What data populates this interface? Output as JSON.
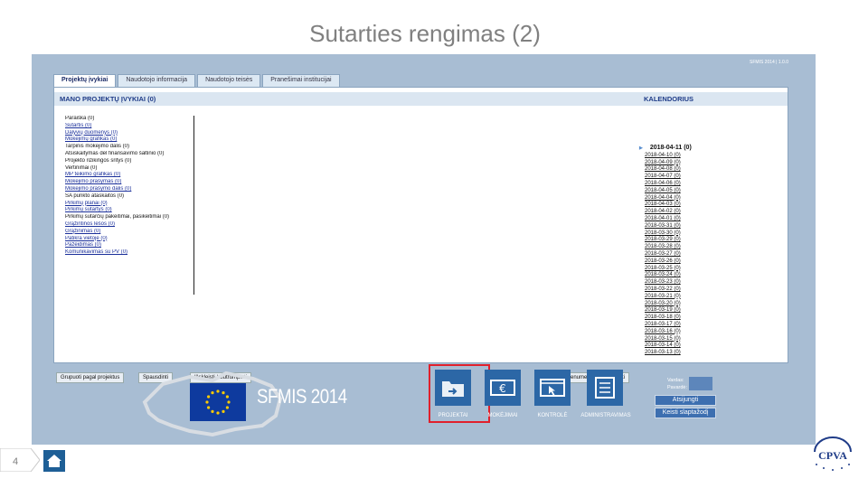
{
  "slide": {
    "title": "Sutarties rengimas (2)",
    "page_number": "4"
  },
  "app": {
    "version": "SFMIS 2014 | 1.0.0",
    "tabs": [
      {
        "label": "Projektų įvykiai",
        "active": true
      },
      {
        "label": "Naudotojo informacija",
        "active": false
      },
      {
        "label": "Naudotojo teisės",
        "active": false
      },
      {
        "label": "Pranešimai institucijai",
        "active": false
      }
    ],
    "panel": {
      "events_header": "MANO PROJEKTŲ ĮVYKIAI (0)",
      "calendar_header": "KALENDORIUS",
      "events": [
        {
          "label": "Paraiška (0)",
          "link": false
        },
        {
          "label": "Sutartis (0)",
          "link": true
        },
        {
          "label": "Dalyvių duomenys (0)",
          "link": true
        },
        {
          "label": "Mokėjimų grafikas (0)",
          "link": true
        },
        {
          "label": "Tarpinis mokėjimo dalis (0)",
          "link": false
        },
        {
          "label": "Atsiskaitymas dėl finansavimo šaltinio (0)",
          "link": false
        },
        {
          "label": "Projekto rizikingos sritys (0)",
          "link": false
        },
        {
          "label": "Vertinimai (0)",
          "link": false
        },
        {
          "label": "MP teikimo grafikas (0)",
          "link": true
        },
        {
          "label": "Mokėjimo prašymas (0)",
          "link": true
        },
        {
          "label": "Mokėjimo prašymo dalis (0)",
          "link": true
        },
        {
          "label": "SA punkto ataskaitos (0)",
          "link": false
        },
        {
          "label": "Pirkimų planai (0)",
          "link": true
        },
        {
          "label": "Pirkimų sutartys (0)",
          "link": true
        },
        {
          "label": "Pirkimų sutarčių pakeitimai, pasikeitimai (0)",
          "link": false
        },
        {
          "label": "Grąžintinos lėšos (0)",
          "link": true
        },
        {
          "label": "Grąžinimas (0)",
          "link": true
        },
        {
          "label": "Patikra vietoje (0)",
          "link": true
        },
        {
          "label": "Pažeidimas (0)",
          "link": true
        },
        {
          "label": "Komunikavimas su PV (0)",
          "link": true
        }
      ],
      "calendar": [
        "2018-04-11 (0)",
        "2018-04-10 (0)",
        "2018-04-09 (0)",
        "2018-04-08 (0)",
        "2018-04-07 (0)",
        "2018-04-06 (0)",
        "2018-04-05 (0)",
        "2018-04-04 (0)",
        "2018-04-03 (0)",
        "2018-04-02 (0)",
        "2018-04-01 (0)",
        "2018-03-31 (0)",
        "2018-03-30 (0)",
        "2018-03-29 (0)",
        "2018-03-28 (0)",
        "2018-03-27 (0)",
        "2018-03-26 (0)",
        "2018-03-25 (0)",
        "2018-03-24 (0)",
        "2018-03-23 (0)",
        "2018-03-22 (0)",
        "2018-03-21 (0)",
        "2018-03-20 (0)",
        "2018-03-19 (0)",
        "2018-03-18 (0)",
        "2018-03-17 (0)",
        "2018-03-16 (0)",
        "2018-03-15 (0)",
        "2018-03-14 (0)",
        "2018-03-13 (0)"
      ],
      "buttons": {
        "group": "Grupuoti pagal projektus",
        "print": "Spausdinti",
        "expand": "Išskleisti / Sutrumpinti",
        "subscribe": "Prenumeruoti / Atsisakyti"
      }
    },
    "footer": {
      "brand": "SFMIS 2014",
      "modules": [
        {
          "label": "PROJEKTAI",
          "icon": "folder-arrow-icon"
        },
        {
          "label": "MOKĖJIMAI",
          "icon": "euro-note-icon"
        },
        {
          "label": "KONTROLĖ",
          "icon": "browser-cursor-icon"
        },
        {
          "label": "ADMINISTRAVIMAS",
          "icon": "checklist-icon"
        }
      ],
      "user": {
        "name_label": "Vardas:",
        "surname_label": "Pavardė:",
        "logout": "Atsijungti",
        "change_password": "Keisti slaptažodį"
      }
    }
  },
  "colors": {
    "app_bg": "#a8bdd3",
    "module_bg": "#2c67a6",
    "highlight": "#e0202c",
    "header_text": "#1f3c88"
  }
}
